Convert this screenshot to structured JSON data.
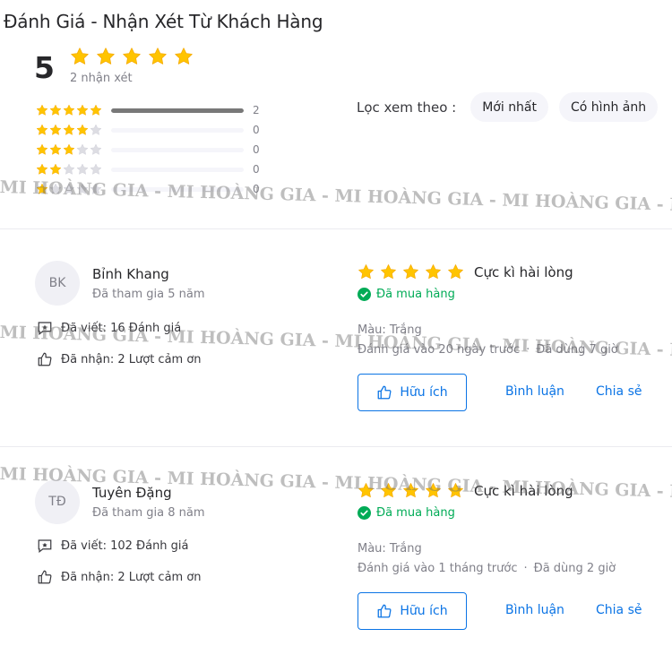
{
  "title": "Đánh Giá - Nhận Xét Từ Khách Hàng",
  "summary": {
    "score": "5",
    "stars_filled": 5,
    "review_count_text": "2 nhận xét"
  },
  "distribution": [
    {
      "stars": 5,
      "count": "2",
      "fill_fraction": 1.0
    },
    {
      "stars": 4,
      "count": "0",
      "fill_fraction": 0
    },
    {
      "stars": 3,
      "count": "0",
      "fill_fraction": 0
    },
    {
      "stars": 2,
      "count": "0",
      "fill_fraction": 0
    },
    {
      "stars": 1,
      "count": "0",
      "fill_fraction": 0
    }
  ],
  "filter": {
    "label": "Lọc xem theo :",
    "chips": [
      "Mới nhất",
      "Có hình ảnh"
    ]
  },
  "watermark": "MI HOÀNG GIA - MI HOÀNG GIA - MI HOÀNG GIA - MI HOÀNG GIA - MI HOÀNG GIA",
  "reviews": [
    {
      "initials": "BK",
      "name": "Bỉnh Khang",
      "joined": "Đã tham gia 5 năm",
      "written": "Đã viết: 16 Đánh giá",
      "thanks": "Đã nhận: 2 Lượt cảm ơn",
      "stars": 5,
      "verdict": "Cực kì hài lòng",
      "bought": "Đã mua hàng",
      "attribute": "Màu: Trắng",
      "posted": "Đánh giá vào 20 ngày trước",
      "used": "Đã dùng 7 giờ",
      "useful_label": "Hữu ích",
      "comment_label": "Bình luận",
      "share_label": "Chia sẻ"
    },
    {
      "initials": "TĐ",
      "name": "Tuyên Đặng",
      "joined": "Đã tham gia 8 năm",
      "written": "Đã viết: 102 Đánh giá",
      "thanks": "Đã nhận: 2 Lượt cảm ơn",
      "stars": 5,
      "verdict": "Cực kì hài lòng",
      "bought": "Đã mua hàng",
      "attribute": "Màu: Trắng",
      "posted": "Đánh giá vào 1 tháng trước",
      "used": "Đã dùng 2 giờ",
      "useful_label": "Hữu ích",
      "comment_label": "Bình luận",
      "share_label": "Chia sẻ"
    }
  ],
  "colors": {
    "star_fill": "#ffc400",
    "star_empty": "#dddde3",
    "accent_blue": "#0b74e5",
    "bought_green": "#00ab56"
  },
  "icons": {
    "star": "star-icon",
    "written": "comment-star-icon",
    "thanks": "thumbs-up-icon",
    "bought": "check-circle-icon"
  }
}
